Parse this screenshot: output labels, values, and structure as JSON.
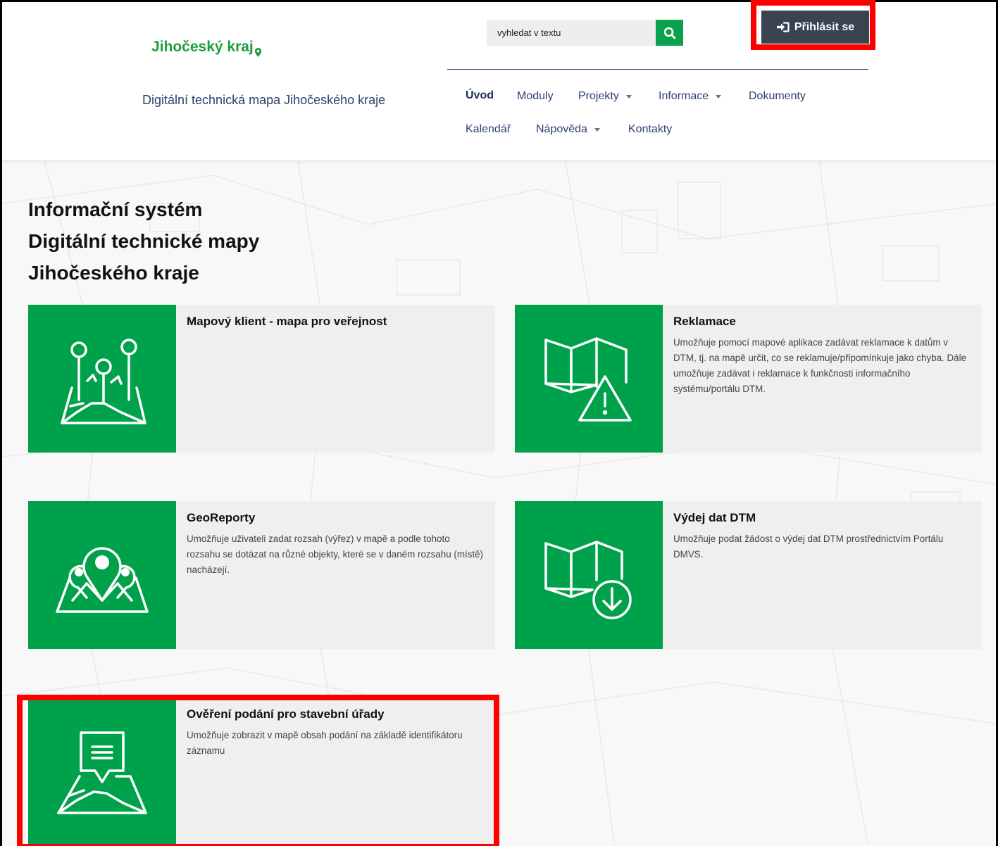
{
  "header": {
    "logo_text": "Jihočeský kraj",
    "subtitle": "Digitální technická mapa Jihočeského kraje",
    "search": {
      "placeholder": "vyhledat v textu"
    },
    "login_label": "Přihlásit se"
  },
  "nav": {
    "items": [
      {
        "label": "Úvod",
        "active": true,
        "dropdown": false
      },
      {
        "label": "Moduly",
        "dropdown": false
      },
      {
        "label": "Projekty",
        "dropdown": true
      },
      {
        "label": "Informace",
        "dropdown": true
      },
      {
        "label": "Dokumenty",
        "dropdown": false
      },
      {
        "label": "Kalendář",
        "dropdown": false
      },
      {
        "label": "Nápověda",
        "dropdown": true
      },
      {
        "label": "Kontakty",
        "dropdown": false
      }
    ]
  },
  "main": {
    "title_lines": [
      "Informační systém",
      "Digitální technické mapy",
      "Jihočeského kraje"
    ],
    "cards": [
      {
        "title": "Mapový klient - mapa pro veřejnost",
        "desc": "",
        "icon": "map-pins-icon"
      },
      {
        "title": "Reklamace",
        "desc": "Umožňuje pomocí mapové aplikace zadávat reklamace k datům v DTM, tj. na mapě určit, co se reklamuje/připomínkuje jako chyba. Dále umožňuje zadávat i reklamace k funkčnosti informačního systému/portálu DTM.",
        "icon": "map-warning-icon"
      },
      {
        "title": "GeoReporty",
        "desc": "Umožňuje uživateli zadat rozsah (výřez) v mapě a podle tohoto rozsahu se dotázat na různé objekty, které se v daném rozsahu (místě) nacházejí.",
        "icon": "map-location-icon"
      },
      {
        "title": "Výdej dat DTM",
        "desc": "Umožňuje podat žádost o výdej dat DTM prostřednictvím Portálu DMVS.",
        "icon": "map-download-icon"
      },
      {
        "title": "Ověření podání pro stavební úřady",
        "desc": "Umožňuje zobrazit v mapě obsah podání na základě identifikátoru záznamu",
        "icon": "map-message-icon"
      }
    ]
  },
  "colors": {
    "accent_green": "#00a14b",
    "nav_blue": "#2b3f70",
    "login_dark": "#3b4250",
    "highlight_red": "#ff0000"
  }
}
